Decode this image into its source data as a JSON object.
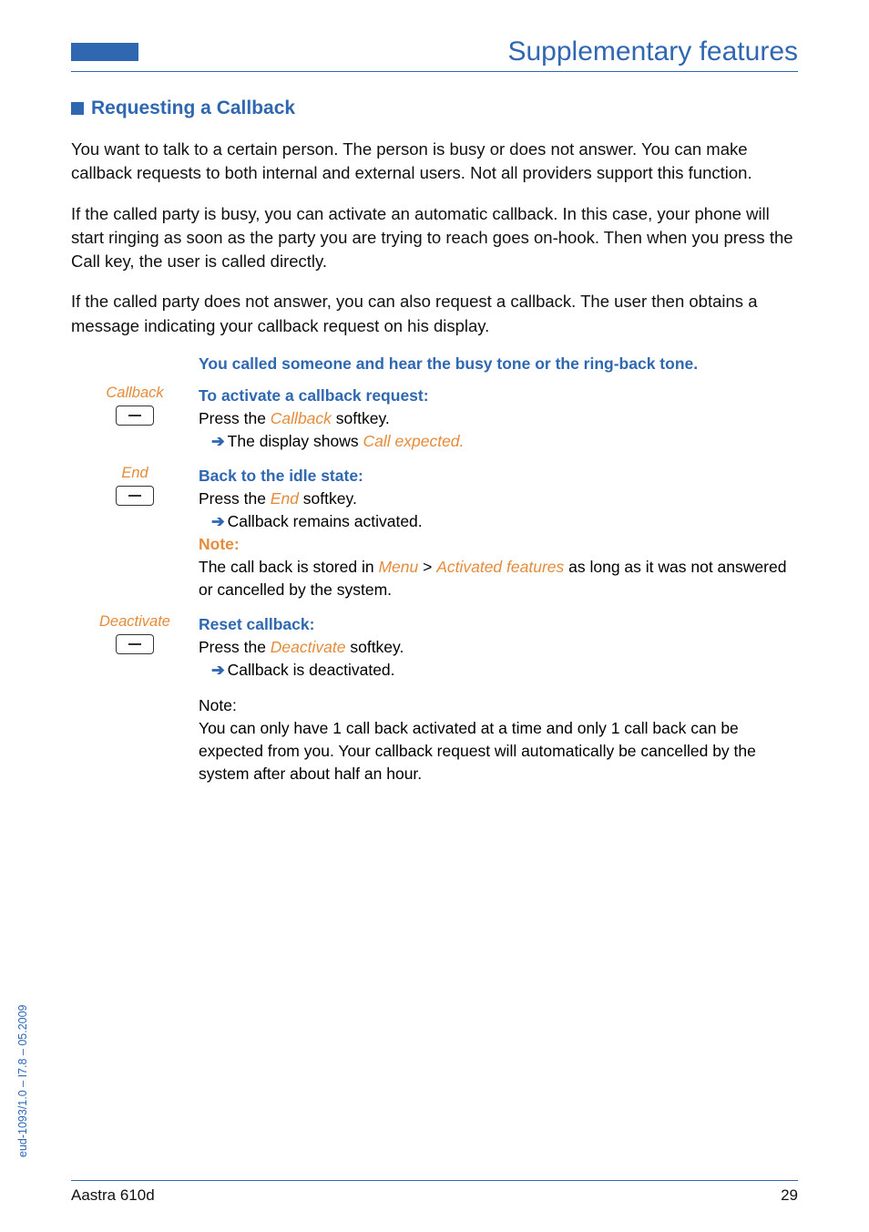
{
  "header": {
    "running_title": "Supplementary features"
  },
  "section": {
    "title": "Requesting a Callback"
  },
  "paragraphs": {
    "p1": "You want to talk to a certain person. The person is busy or does not answer. You can make callback requests to both internal and external users. Not all providers support this function.",
    "p2": "If the called party is busy, you can activate an automatic callback. In this case, your phone will start ringing as soon as the party you are trying to reach goes on-hook. Then when you press the Call key, the user is called directly.",
    "p3": "If the called party does not answer, you can also request a callback. The user then obtains a message indicating your callback request on his display."
  },
  "lead": "You called someone and hear the busy tone or the ring-back tone.",
  "steps": {
    "callback": {
      "label": "Callback",
      "title": "To activate a callback request:",
      "line1a": "Press the ",
      "line1b": "Callback",
      "line1c": " softkey.",
      "line2a": "The display shows ",
      "line2b": "Call expected."
    },
    "end": {
      "label": "End",
      "title": "Back to the idle state:",
      "line1a": "Press the ",
      "line1b": "End",
      "line1c": " softkey.",
      "line2": "Callback remains activated.",
      "note_label": "Note:",
      "note_a": "The call back is stored in ",
      "note_b": "Menu",
      "note_gt": " > ",
      "note_c": "Activated features",
      "note_d": " as long as it was not answered or cancelled by the system."
    },
    "deactivate": {
      "label": "Deactivate",
      "title": "Reset callback:",
      "line1a": "Press the ",
      "line1b": "Deactivate",
      "line1c": " softkey.",
      "line2": "Callback is deactivated."
    }
  },
  "final_note": {
    "label": "Note:",
    "text": "You can only have 1 call back activated at a time and only 1 call back can be expected from you. Your callback request will automatically be cancelled by the system after about half an hour."
  },
  "side_text": "eud-1093/1.0 – I7.8 – 05.2009",
  "footer": {
    "product": "Aastra 610d",
    "page": "29"
  }
}
